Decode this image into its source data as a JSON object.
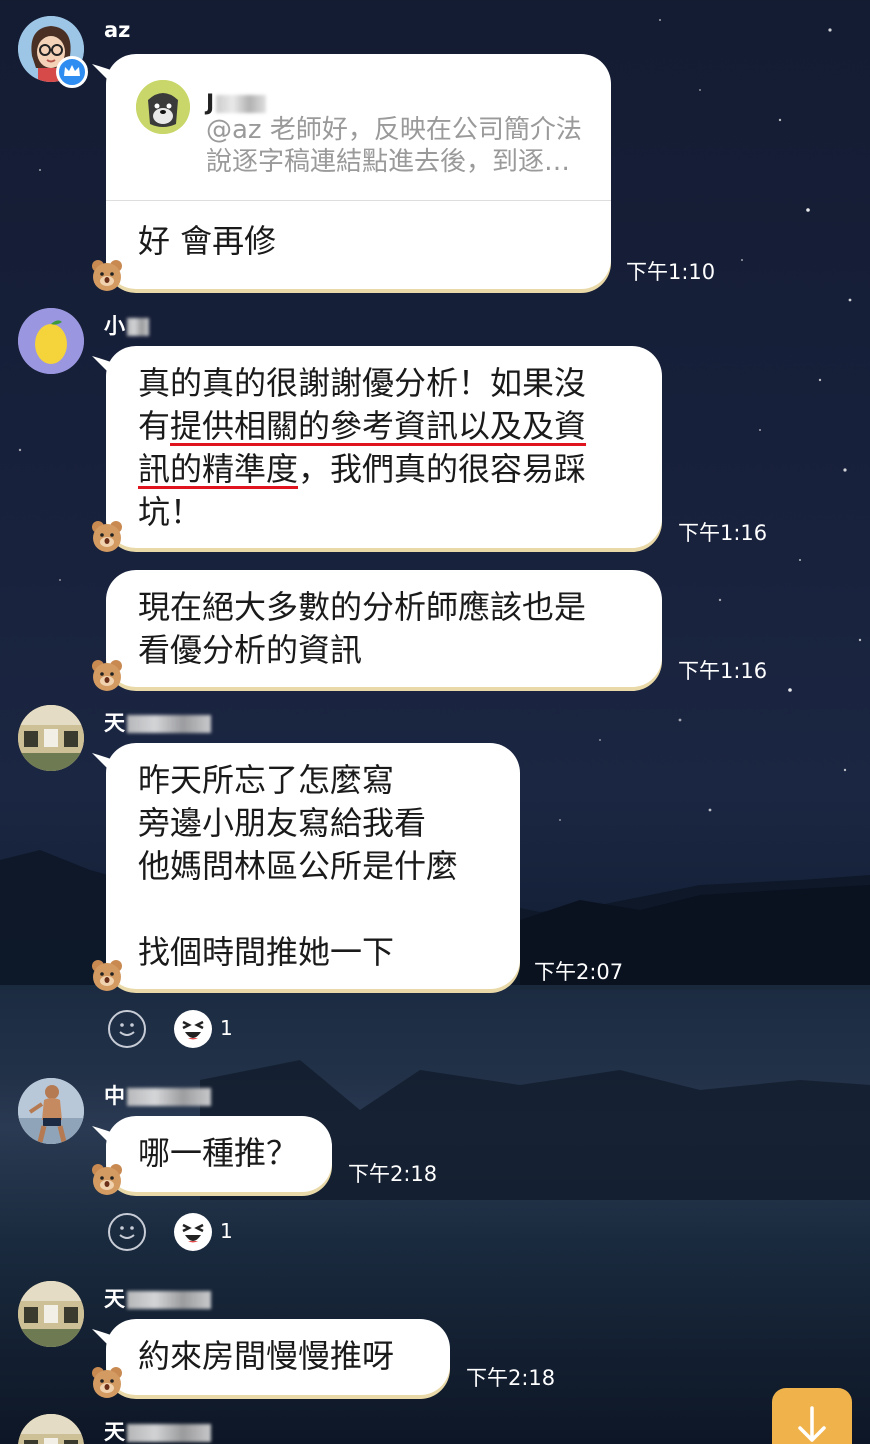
{
  "messages": [
    {
      "sender": "az",
      "quote": {
        "name": "J",
        "text": "@az 老師好，反映在公司簡介法\n說逐字稿連結點進去後，到逐…"
      },
      "text": "好 會再修",
      "time": "下午1:10"
    },
    {
      "sender": "小",
      "text_before": "真的真的很謝謝優分析！如果沒\n有",
      "text_underlined_1": "提供相關的參考資訊以及及資",
      "text_mid": "\n",
      "text_underlined_2": "訊的精準度",
      "text_after": "，我們真的很容易踩\n坑！",
      "time": "下午1:16"
    },
    {
      "sender": "",
      "text": "現在絕大多數的分析師應該也是\n看優分析的資訊",
      "time": "下午1:16"
    },
    {
      "sender": "天",
      "text": "昨天所忘了怎麼寫\n旁邊小朋友寫給我看\n他媽問林區公所是什麼\n\n找個時間推她一下",
      "time": "下午2:07",
      "reaction_count": "1"
    },
    {
      "sender": "中",
      "text": "哪一種推？",
      "time": "下午2:18",
      "reaction_count": "1"
    },
    {
      "sender": "天",
      "text": "約來房間慢慢推呀",
      "time": "下午2:18"
    },
    {
      "sender": "天"
    }
  ],
  "icons": {
    "scroll_down": "arrow-down-icon",
    "add_reaction": "smile-icon",
    "reaction": "laughing-emoji-icon",
    "bear": "bear-sticker-icon",
    "verified": "crown-badge-icon"
  },
  "colors": {
    "bubble": "#ffffff",
    "underline": "#e0141e",
    "scroll_button": "#f0b24a",
    "text": "#1a1a1a"
  }
}
